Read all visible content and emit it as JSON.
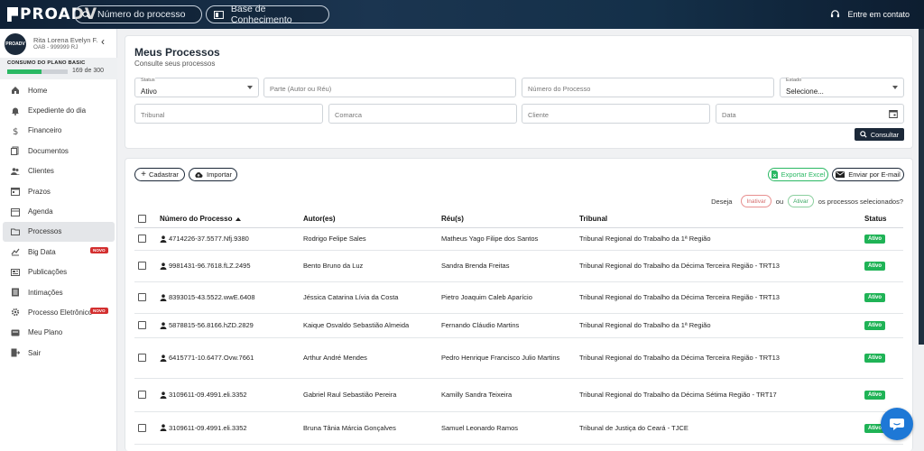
{
  "header": {
    "logo": "PROADV",
    "search_placeholder": "Número do processo",
    "knowledge_base": "Base de Conhecimento",
    "login": "Entre em contato"
  },
  "user": {
    "name": "Rita Lorena Evelyn F.",
    "oab": "OAB - 999999 RJ",
    "avatar_text": "PROADV"
  },
  "plan": {
    "title": "CONSUMO DO PLANO BASIC",
    "used": 169,
    "total": 300,
    "count": "169 de 300"
  },
  "sidebar": {
    "items": [
      {
        "label": "Home",
        "icon": "home-icon"
      },
      {
        "label": "Expediente do dia",
        "icon": "bell-icon"
      },
      {
        "label": "Financeiro",
        "icon": "dollar-icon"
      },
      {
        "label": "Documentos",
        "icon": "documents-icon"
      },
      {
        "label": "Clientes",
        "icon": "users-icon"
      },
      {
        "label": "Prazos",
        "icon": "calendar-icon"
      },
      {
        "label": "Agenda",
        "icon": "agenda-icon"
      },
      {
        "label": "Processos",
        "icon": "folder-icon",
        "active": true
      },
      {
        "label": "Big Data",
        "icon": "chart-icon",
        "badge": "NOVO"
      },
      {
        "label": "Publicações",
        "icon": "newspaper-icon"
      },
      {
        "label": "Intimações",
        "icon": "list-icon"
      },
      {
        "label": "Processo Eletrônico",
        "icon": "cog-icon",
        "badge": "NOVO"
      },
      {
        "label": "Meu Plano",
        "icon": "plan-icon"
      },
      {
        "label": "Sair",
        "icon": "logout-icon"
      }
    ]
  },
  "filters": {
    "title": "Meus Processos",
    "subtitle": "Consulte seus processos",
    "status_label": "Status",
    "status_value": "Ativo",
    "parte_placeholder": "Parte (Autor ou Réu)",
    "numero_placeholder": "Número do Processo",
    "estado_label": "Estado",
    "estado_value": "Selecione...",
    "tribunal_placeholder": "Tribunal",
    "comarca_placeholder": "Comarca",
    "cliente_placeholder": "Cliente",
    "data_placeholder": "Data",
    "consultar": "Consultar"
  },
  "actions": {
    "cadastrar": "Cadastrar",
    "importar": "Importar",
    "exportar_excel": "Exportar Excel",
    "enviar_email": "Enviar por E-mail",
    "deseja": "Deseja",
    "inativar": "Inativar",
    "ou": "ou",
    "ativar": "Ativar",
    "selecionados": "os processos selecionados?"
  },
  "table": {
    "headers": [
      "Número do Processo",
      "Autor(es)",
      "Réu(s)",
      "Tribunal",
      "Status"
    ],
    "rows": [
      {
        "numero": "4714226-37.5577.Nfj.9380",
        "autor": "Rodrigo Felipe Sales",
        "reu": "Matheus Yago Filipe dos Santos",
        "tribunal": "Tribunal Regional do Trabalho da 1ª Região",
        "status": "Ativo"
      },
      {
        "numero": "9981431-96.7618.fLZ.2495",
        "autor": "Bento Bruno da Luz",
        "reu": "Sandra Brenda Freitas",
        "tribunal": "Tribunal Regional do Trabalho da Décima Terceira Região - TRT13",
        "status": "Ativo"
      },
      {
        "numero": "8393015-43.5522.wwE.6408",
        "autor": "Jéssica Catarina Lívia da Costa",
        "reu": "Pietro Joaquim Caleb Aparício",
        "tribunal": "Tribunal Regional do Trabalho da Décima Terceira Região - TRT13",
        "status": "Ativo"
      },
      {
        "numero": "5878815-56.8166.hZD.2829",
        "autor": "Kaique Osvaldo Sebastião Almeida",
        "reu": "Fernando Cláudio Martins",
        "tribunal": "Tribunal Regional do Trabalho da 1ª Região",
        "status": "Ativo"
      },
      {
        "numero": "6415771-10.6477.Ovw.7661",
        "autor": "Arthur André Mendes",
        "reu": "Pedro Henrique Francisco Julio Martins",
        "tribunal": "Tribunal Regional do Trabalho da Décima Terceira Região - TRT13",
        "status": "Ativo"
      },
      {
        "numero": "3109611-09.4991.eli.3352",
        "autor": "Gabriel Raul Sebastião Pereira",
        "reu": "Kamilly Sandra Teixeira",
        "tribunal": "Tribunal Regional do Trabalho da Décima Sétima Região - TRT17",
        "status": "Ativo"
      },
      {
        "numero": "3109611-09.4991.eli.3352",
        "autor": "Bruna Tânia Márcia Gonçalves",
        "reu": "Samuel Leonardo Ramos",
        "tribunal": "Tribunal de Justiça do Ceará - TJCE",
        "status": "Ativo"
      }
    ]
  },
  "colors": {
    "accent": "#1b2838",
    "status_green": "#1fb356",
    "badge_red": "#d32f2f",
    "chat_blue": "#1e78d6"
  }
}
